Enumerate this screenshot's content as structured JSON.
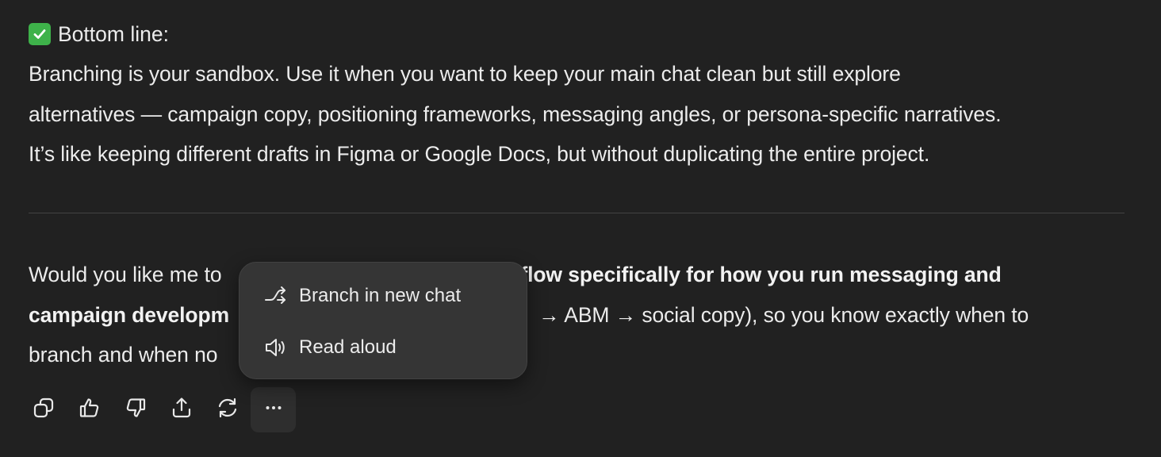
{
  "message": {
    "heading": "Bottom line:",
    "paragraph1_lines": [
      "Branching is your sandbox. Use it when you want to keep your main chat clean but still explore",
      "alternatives — campaign copy, positioning frameworks, messaging angles, or persona-specific narratives.",
      "It’s like keeping different drafts in Figma or Google Docs, but without duplicating the entire project."
    ],
    "paragraph2": {
      "line1_regular": "Would you like me to",
      "line1_bold": "rkflow specifically for how you run messaging and",
      "line2_bold": "campaign developm",
      "line2_regular": "→ ABM → social copy), so you know exactly when to",
      "line3_regular": "branch and when no"
    }
  },
  "actions": [
    {
      "name": "copy-icon"
    },
    {
      "name": "thumbs-up-icon"
    },
    {
      "name": "thumbs-down-icon"
    },
    {
      "name": "share-icon"
    },
    {
      "name": "regenerate-icon"
    },
    {
      "name": "more-icon"
    }
  ],
  "menu": {
    "items": [
      {
        "label": "Branch in new chat",
        "icon": "branch-icon"
      },
      {
        "label": "Read aloud",
        "icon": "speaker-icon"
      }
    ]
  },
  "colors": {
    "background": "#212121",
    "text": "#ececec",
    "menu_bg": "#353535",
    "check_green": "#3eb24a"
  }
}
